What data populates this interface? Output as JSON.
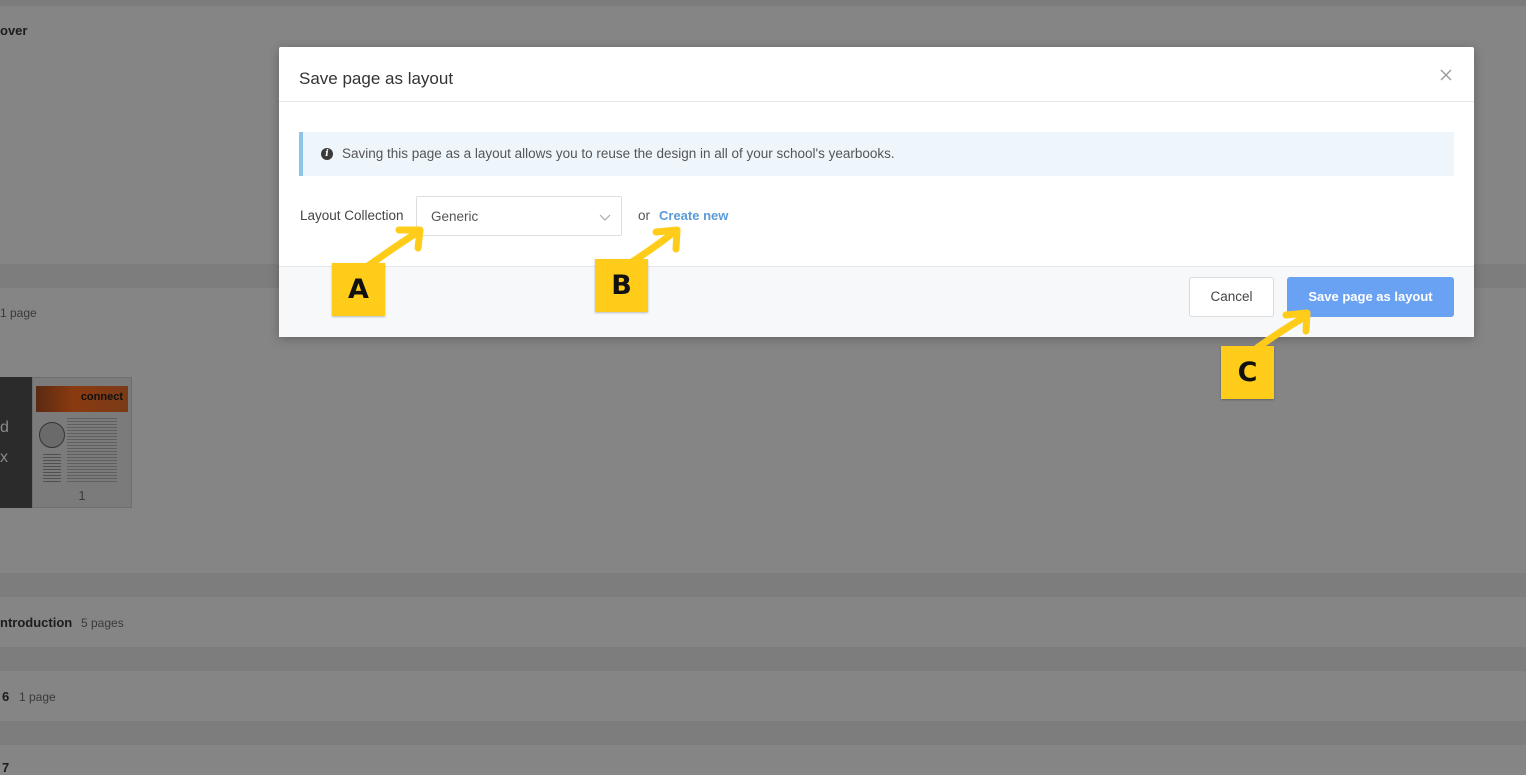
{
  "background": {
    "cover_title": "over",
    "section1_count": "1 page",
    "thumbnail": {
      "header_text": "connect",
      "page_number": "1"
    },
    "dark_tile_letters": [
      "d",
      "x"
    ],
    "introduction": {
      "title": "ntroduction",
      "count": "5 pages"
    },
    "section6": {
      "title": "6",
      "count": "1 page"
    },
    "section7": {
      "title": "7"
    }
  },
  "modal": {
    "title": "Save page as layout",
    "close_icon": "close-icon",
    "info": {
      "icon": "info-icon",
      "icon_glyph": "i",
      "text": "Saving this page as a layout allows you to reuse the design in all of your school's yearbooks."
    },
    "layout_collection": {
      "label": "Layout Collection",
      "selected": "Generic",
      "chevron_icon": "chevron-down-icon"
    },
    "or_text": "or",
    "create_new_link": "Create new",
    "cancel_button": "Cancel",
    "save_button": "Save page as layout"
  },
  "annotations": {
    "a": "A",
    "b": "B",
    "c": "C",
    "color": "#ffcc1a"
  },
  "colors": {
    "accent": "#6aa2f3",
    "link": "#5b9bd8",
    "info_bg": "#eef6fc",
    "info_border": "#8cc4ec"
  }
}
